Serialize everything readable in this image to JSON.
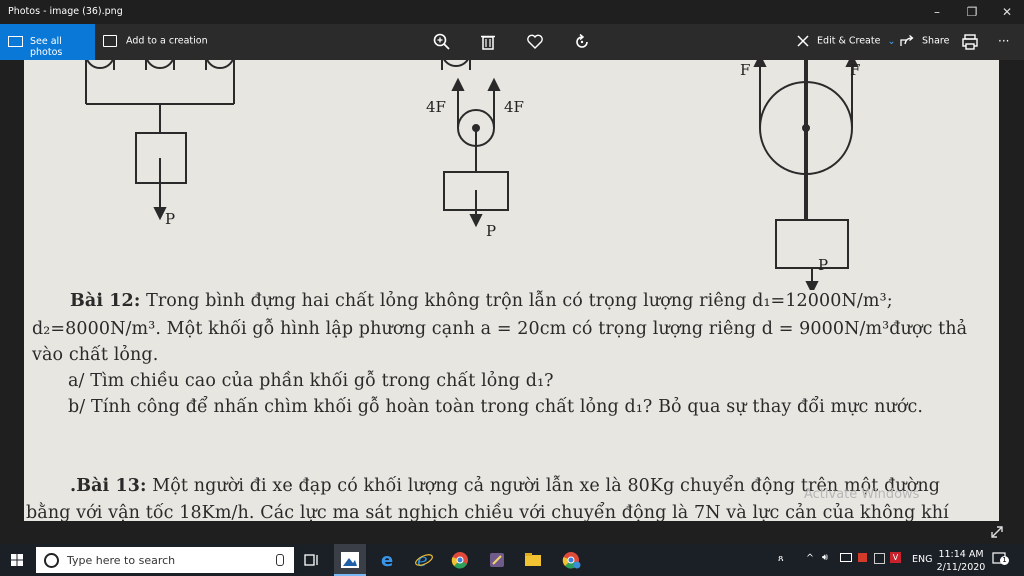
{
  "window": {
    "title": "Photos - image (36).png",
    "controls": {
      "minimize": "–",
      "restore": "❐",
      "close": "✕"
    }
  },
  "toolbar": {
    "see_all_photos": "See all photos",
    "add_to_creation": "Add to a creation",
    "edit_create": "Edit & Create",
    "share": "Share",
    "more": "···",
    "icons": [
      "zoom-icon",
      "delete-icon",
      "favorite-icon",
      "rotate-icon",
      "edit-create-icon",
      "share-icon",
      "print-icon"
    ]
  },
  "document": {
    "diagram_labels": {
      "left_p": "P",
      "mid_4f_left": "4F",
      "mid_4f_right": "4F",
      "mid_p": "P",
      "right_f_left": "F",
      "right_f_right": "F",
      "right_p": "P"
    },
    "bai12": {
      "heading": "Bài 12:",
      "line1": "Trong bình đựng hai chất lỏng không trộn lẫn có trọng lượng riêng d₁=12000N/m³;",
      "line2": "d₂=8000N/m³. Một khối gỗ hình lập phương cạnh a = 20cm có trọng lượng riêng d = 9000N/m³được thả",
      "line3": "vào chất lỏng.",
      "a": "a/ Tìm chiều cao của phần khối gỗ trong chất lỏng d₁?",
      "b": "b/ Tính công để nhấn chìm khối gỗ hoàn toàn trong chất lỏng d₁? Bỏ qua sự thay đổi mực nước."
    },
    "bai13": {
      "heading": ".Bài 13:",
      "line1": "Một người đi xe đạp có khối lượng cả người lẫn xe là 80Kg chuyển động trên một đường",
      "line2": "bằng với vận tốc 18Km/h. Các lực ma sát nghịch chiều với chuyển động là 7N và lực cản của không khí"
    },
    "watermark": "Activate Windows"
  },
  "taskbar": {
    "search_placeholder": "Type here to search",
    "apps": [
      "task-view-icon",
      "photos-app-icon",
      "edge-icon",
      "ie-icon",
      "chrome-icon",
      "paint-icon",
      "file-explorer-icon",
      "chrome-alt-icon"
    ],
    "tray": {
      "language": "ENG",
      "time": "11:14 AM",
      "date": "2/11/2020",
      "notifications": "1"
    }
  },
  "colors": {
    "accent": "#0a78d7",
    "titlebar": "#1f1f1f",
    "toolbar": "#2b2b2b",
    "paper": "#e7e6e1",
    "taskbar": "#1b1f26"
  }
}
